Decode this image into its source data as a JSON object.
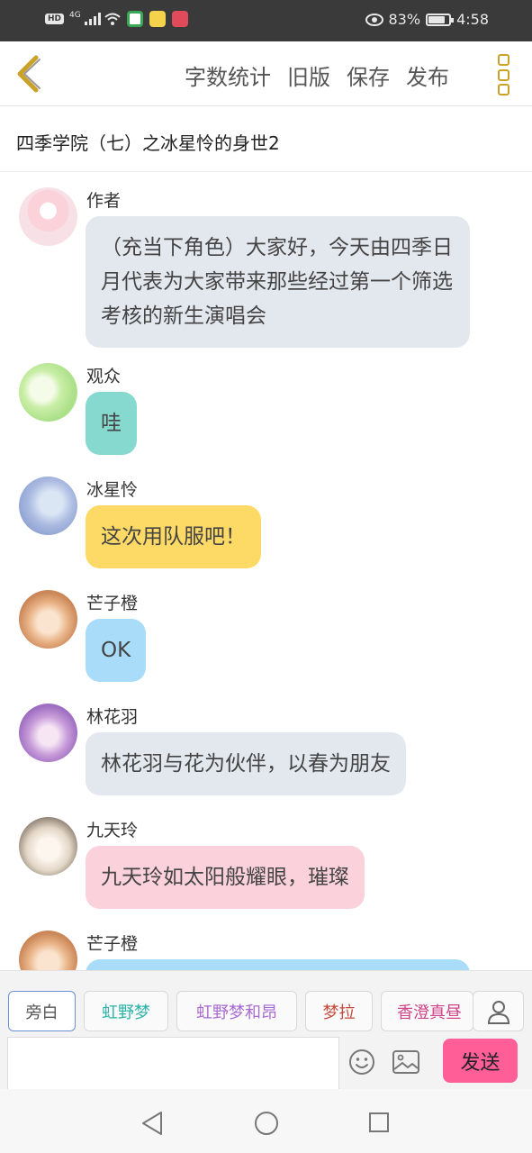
{
  "status_bar": {
    "hd": "HD",
    "network": "4G",
    "battery_percent": "83%",
    "battery_level": 0.83,
    "time": "4:58"
  },
  "toolbar": {
    "actions": [
      "字数统计",
      "旧版",
      "保存",
      "发布"
    ],
    "back_icon": "chevron-left-icon",
    "more_icon": "more-vertical-icon",
    "accent_color": "#c9a227"
  },
  "title": "四季学院（七）之冰星怜的身世2",
  "messages": [
    {
      "name": "作者",
      "text": "（充当下角色）大家好，今天由四季日月代表为大家带来那些经过第一个筛选考核的新生演唱会",
      "bubble_color": "#e3e8ef"
    },
    {
      "name": "观众",
      "text": "哇",
      "bubble_color": "#86d9cf"
    },
    {
      "name": "冰星怜",
      "text": "这次用队服吧！",
      "bubble_color": "#fdd966"
    },
    {
      "name": "芒子橙",
      "text": "OK",
      "bubble_color": "#a9dcf9"
    },
    {
      "name": "林花羽",
      "text": "林花羽与花为伙伴，以春为朋友",
      "bubble_color": "#e3e8ef"
    },
    {
      "name": "九天玲",
      "text": "九天玲如太阳般耀眼，璀璨",
      "bubble_color": "#fbd1dc"
    },
    {
      "name": "芒子橙",
      "text": "",
      "bubble_color": "#a9dcf9"
    }
  ],
  "roles": [
    {
      "label": "旁白",
      "color": "#555555"
    },
    {
      "label": "虹野梦",
      "color": "#2bb3a7"
    },
    {
      "label": "虹野梦和昂",
      "color": "#a86ad0"
    },
    {
      "label": "梦拉",
      "color": "#c44a3a"
    },
    {
      "label": "香澄真昼",
      "color": "#d0458a"
    }
  ],
  "composer": {
    "input_value": "",
    "send_label": "发送",
    "send_color": "#ff5e96",
    "icons": [
      "person-icon",
      "emoji-icon",
      "image-icon"
    ]
  },
  "nav": {
    "icons": [
      "back-triangle-icon",
      "home-circle-icon",
      "recent-square-icon"
    ]
  }
}
